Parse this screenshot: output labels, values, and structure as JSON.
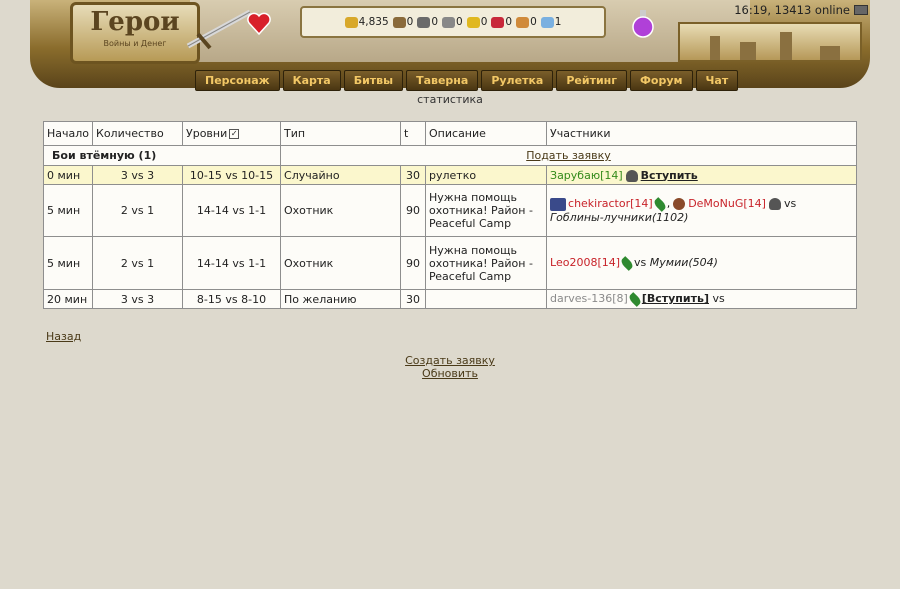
{
  "header": {
    "logo_title": "Герои",
    "logo_subtitle": "Войны и Денег",
    "resources": [
      {
        "icon": "gold-icon",
        "value": "4,835",
        "color": "#d8a82a"
      },
      {
        "icon": "wood-icon",
        "value": "0",
        "color": "#8a6a3a"
      },
      {
        "icon": "ore-icon",
        "value": "0",
        "color": "#6a6a6a"
      },
      {
        "icon": "mercury-icon",
        "value": "0",
        "color": "#888"
      },
      {
        "icon": "sulfur-icon",
        "value": "0",
        "color": "#e0b820"
      },
      {
        "icon": "crystal-icon",
        "value": "0",
        "color": "#c8283a"
      },
      {
        "icon": "gems-icon",
        "value": "0",
        "color": "#d08a3a"
      },
      {
        "icon": "diamond-icon",
        "value": "1",
        "color": "#7ab0e0"
      }
    ]
  },
  "status": {
    "time": "16:19, 13413 online"
  },
  "nav": [
    "Персонаж",
    "Карта",
    "Битвы",
    "Таверна",
    "Рулетка",
    "Рейтинг",
    "Форум",
    "Чат"
  ],
  "page": {
    "subtitle": "статистика"
  },
  "table": {
    "headers": {
      "start": "Начало",
      "count": "Количество",
      "levels": "Уровни",
      "type": "Тип",
      "t": "t",
      "desc": "Описание",
      "participants": "Участники"
    },
    "group_label": "Бои втёмную (1)",
    "apply_link": "Подать заявку",
    "rows": [
      {
        "start": "0 мин",
        "count": "3 vs 3",
        "levels": "10-15 vs 10-15",
        "type": "Случайно",
        "t": "30",
        "desc": "рулетко",
        "p1": "Зарубаю[14]",
        "join": "Вступить"
      },
      {
        "start": "5 мин",
        "count": "2 vs 1",
        "levels": "14-14 vs 1-1",
        "type": "Охотник",
        "t": "90",
        "desc": "Нужна помощь охотника! Район - Peaceful Camp",
        "p1": "chekiractor[14]",
        "p2": "DeMoNuG[14]",
        "vs": "vs",
        "enemy": "Гоблины-лучники(1102)"
      },
      {
        "start": "5 мин",
        "count": "2 vs 1",
        "levels": "14-14 vs 1-1",
        "type": "Охотник",
        "t": "90",
        "desc": "Нужна помощь охотника! Район - Peaceful Camp",
        "p1": "Leo2008[14]",
        "vs": "vs",
        "enemy": "Мумии(504)"
      },
      {
        "start": "20 мин",
        "count": "3 vs 3",
        "levels": "8-15 vs 8-10",
        "type": "По желанию",
        "t": "30",
        "desc": "",
        "p1": "darves-136[8]",
        "join": "[Вступить]",
        "vs": "vs"
      }
    ]
  },
  "links": {
    "back": "Назад",
    "create": "Создать заявку",
    "refresh": "Обновить"
  }
}
